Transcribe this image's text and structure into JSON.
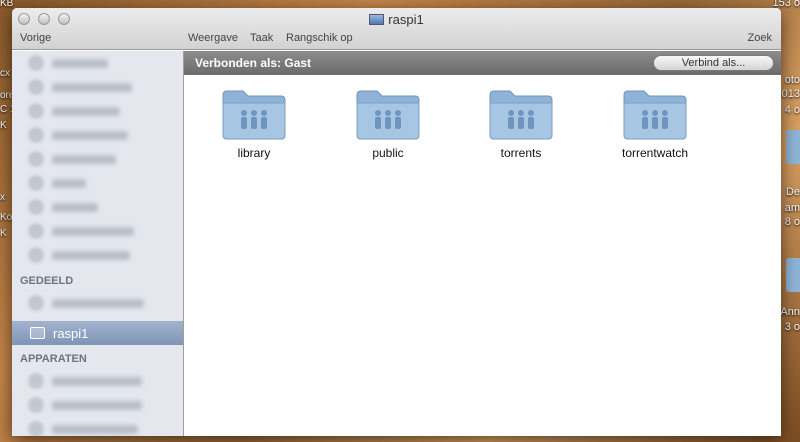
{
  "window": {
    "title": "raspi1"
  },
  "toolbar": {
    "back_label": "Vorige",
    "view_label": "Weergave",
    "action_label": "Taak",
    "arrange_label": "Rangschik op",
    "search_label": "Zoek"
  },
  "sidebar": {
    "shared_header": "GEDEELD",
    "selected_item": "raspi1",
    "devices_header": "APPARATEN"
  },
  "connection": {
    "status_label": "Verbonden als: Gast",
    "connect_button": "Verbind als..."
  },
  "folders": [
    {
      "name": "library",
      "icon": "shared-folder-icon"
    },
    {
      "name": "public",
      "icon": "shared-folder-icon"
    },
    {
      "name": "torrents",
      "icon": "shared-folder-icon"
    },
    {
      "name": "torrentwatch",
      "icon": "shared-folder-icon"
    }
  ],
  "desktop": {
    "right_items": [
      "153 o",
      "oto",
      "013",
      "4 o",
      "De",
      "am",
      "8 o",
      "Ann",
      "3 o"
    ],
    "left_items": [
      "KB",
      "cx",
      "ore",
      "C 1",
      "K",
      "x",
      "Ko",
      "K"
    ]
  },
  "colors": {
    "connection_bar": "#7a7a7a",
    "sidebar_bg": "#e4e8ee",
    "sidebar_selection": "#8ea2c2",
    "folder_blue": "#8fb3d6"
  }
}
